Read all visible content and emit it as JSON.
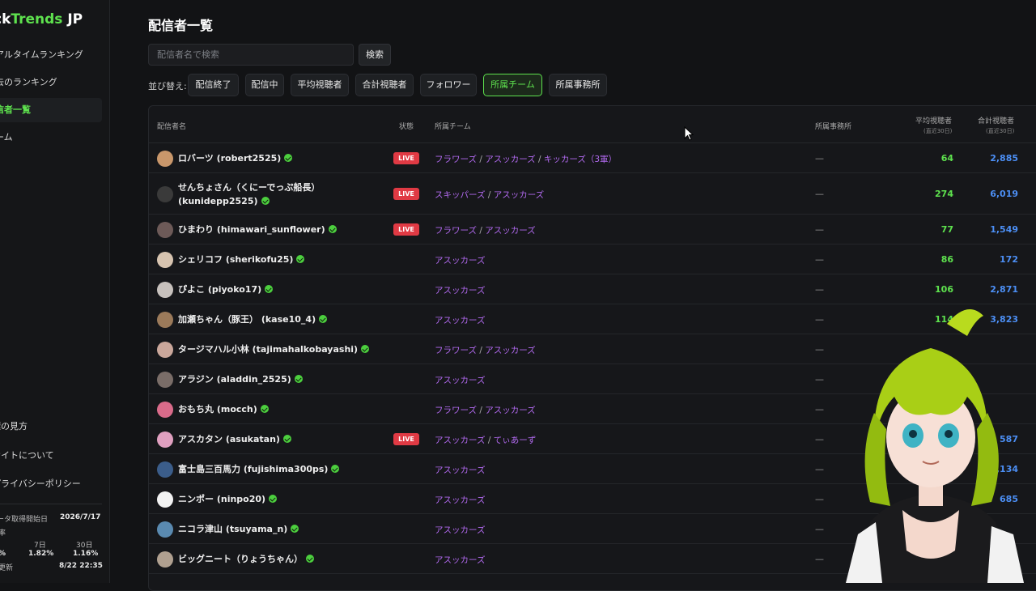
{
  "sidebar": {
    "brand_prefix": "ck",
    "brand_green": "Trends",
    "brand_suffix": " JP",
    "nav": [
      {
        "label": "アルタイムランキング"
      },
      {
        "label": "去のランキング"
      },
      {
        "label": "信者一覧"
      },
      {
        "label": "ーム"
      }
    ],
    "links": [
      {
        "label": "標の見方"
      },
      {
        "label": "サイトについて"
      },
      {
        "label": "プライバシーポリシー"
      }
    ],
    "stats": {
      "start_label": "ータ取得開始日",
      "start_value": "2026/7/17",
      "rate_label": "率",
      "col7_label": "7日",
      "col30_label": "30日",
      "col1_value": "%",
      "col7_value": "1.82%",
      "col30_value": "1.16%",
      "update_label": "更新",
      "update_value": "8/22 22:35"
    }
  },
  "main": {
    "title": "配信者一覧",
    "search_placeholder": "配信者名で検索",
    "search_button": "検索",
    "sort_label": "並び替え:",
    "sort_buttons": [
      {
        "label": "配信終了"
      },
      {
        "label": "配信中"
      },
      {
        "label": "平均視聴者"
      },
      {
        "label": "合計視聴者"
      },
      {
        "label": "フォロワー"
      },
      {
        "label": "所属チーム"
      },
      {
        "label": "所属事務所"
      }
    ],
    "active_sort": "所属チーム"
  },
  "table": {
    "headers": {
      "name": "配信者名",
      "status": "状態",
      "team": "所属チーム",
      "agency": "所属事務所",
      "avg": "平均視聴者",
      "avg_sub": "(直近30日)",
      "total": "合計視聴者",
      "total_sub": "(直近30日)"
    },
    "live_label": "LIVE",
    "dash": "—",
    "rows": [
      {
        "line1": "ロバーツ (robert2525)",
        "line2": "",
        "live": true,
        "teams": [
          "フラワーズ",
          "アスッカーズ",
          "キッカーズ（3軍）"
        ],
        "avg": "64",
        "total": "2,885"
      },
      {
        "line1": "せんちょさん（くにーでっぷ船長）",
        "line2": "(kunidepp2525)",
        "live": true,
        "teams": [
          "スキッパーズ",
          "アスッカーズ"
        ],
        "avg": "274",
        "total": "6,019"
      },
      {
        "line1": "ひまわり (himawari_sunflower)",
        "line2": "",
        "live": true,
        "teams": [
          "フラワーズ",
          "アスッカーズ"
        ],
        "avg": "77",
        "total": "1,549"
      },
      {
        "line1": "シェリコフ (sherikofu25)",
        "line2": "",
        "live": false,
        "teams": [
          "アスッカーズ"
        ],
        "avg": "86",
        "total": "172"
      },
      {
        "line1": "ぴよこ (piyoko17)",
        "line2": "",
        "live": false,
        "teams": [
          "アスッカーズ"
        ],
        "avg": "106",
        "total": "2,871"
      },
      {
        "line1": "加瀬ちゃん（豚王） (kase10_4)",
        "line2": "",
        "live": false,
        "teams": [
          "アスッカーズ"
        ],
        "avg": "114",
        "total": "3,823"
      },
      {
        "line1": "タージマハル小林 (tajimahalkobayashi)",
        "line2": "",
        "live": false,
        "teams": [
          "フラワーズ",
          "アスッカーズ"
        ],
        "avg": "",
        "total": ""
      },
      {
        "line1": "アラジン (aladdin_2525)",
        "line2": "",
        "live": false,
        "teams": [
          "アスッカーズ"
        ],
        "avg": "",
        "total": ""
      },
      {
        "line1": "おもち丸 (mocch)",
        "line2": "",
        "live": false,
        "teams": [
          "フラワーズ",
          "アスッカーズ"
        ],
        "avg": "",
        "total": ""
      },
      {
        "line1": "アスカタン (asukatan)",
        "line2": "",
        "live": true,
        "teams": [
          "アスッカーズ",
          "てぃあーず"
        ],
        "avg": "",
        "total": "587"
      },
      {
        "line1": "富士島三百馬力 (fujishima300ps)",
        "line2": "",
        "live": false,
        "teams": [
          "アスッカーズ"
        ],
        "avg": "",
        "total": "1,134"
      },
      {
        "line1": "ニンポー (ninpo20)",
        "line2": "",
        "live": false,
        "teams": [
          "アスッカーズ"
        ],
        "avg": "",
        "total": "685"
      },
      {
        "line1": "ニコラ津山 (tsuyama_n)",
        "line2": "",
        "live": false,
        "teams": [
          "アスッカーズ"
        ],
        "avg": "",
        "total": ""
      },
      {
        "line1": "ビッグニート（りょうちゃん）",
        "line2": "",
        "live": false,
        "teams": [
          "アスッカーズ"
        ],
        "avg": "",
        "total": ""
      }
    ]
  },
  "colors": {
    "accent": "#5ee24e",
    "team": "#b26af0",
    "total": "#4c8ff5",
    "live": "#e03a44"
  }
}
